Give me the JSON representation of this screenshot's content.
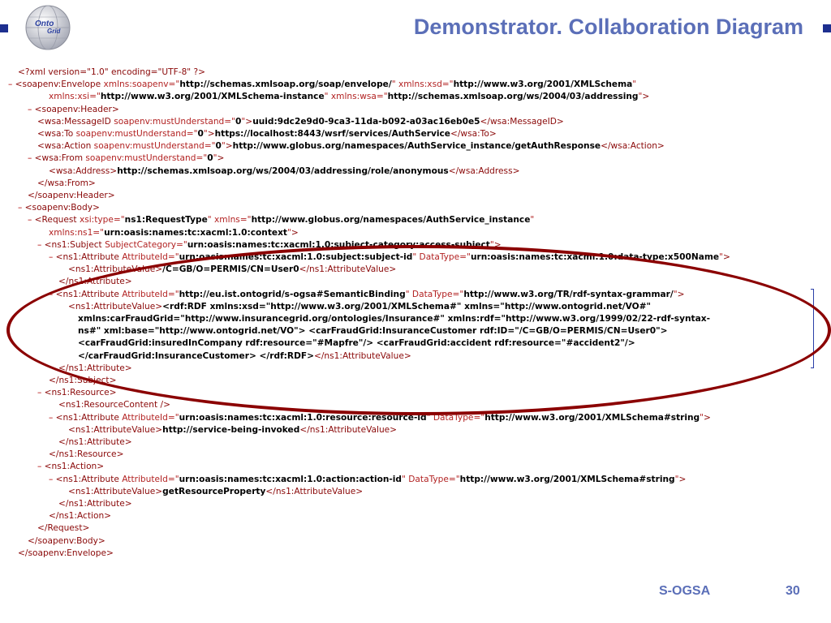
{
  "slide": {
    "title": "Demonstrator. Collaboration Diagram",
    "footer_left": "S-OGSA",
    "footer_page": "30",
    "logo_line1": "Onto",
    "logo_line2": "Grid"
  },
  "xml_lines": [
    [
      {
        "c": "tg",
        "t": "<?xml version=\"1.0\" encoding=\"UTF-8\" ?>"
      }
    ],
    [
      {
        "c": "mk",
        "t": "– "
      },
      {
        "c": "tg",
        "t": "<soapenv:Envelope "
      },
      {
        "c": "an",
        "t": "xmlns:soapenv=\""
      },
      {
        "c": "av",
        "t": "http://schemas.xmlsoap.org/soap/envelope/"
      },
      {
        "c": "an",
        "t": "\" xmlns:xsd=\""
      },
      {
        "c": "av",
        "t": "http://www.w3.org/2001/XMLSchema"
      },
      {
        "c": "an",
        "t": "\""
      }
    ],
    [
      {
        "c": "an",
        "t": "xmlns:xsi=\""
      },
      {
        "c": "av",
        "t": "http://www.w3.org/2001/XMLSchema-instance"
      },
      {
        "c": "an",
        "t": "\" xmlns:wsa=\""
      },
      {
        "c": "av",
        "t": "http://schemas.xmlsoap.org/ws/2004/03/addressing"
      },
      {
        "c": "an",
        "t": "\""
      },
      {
        "c": "tg",
        "t": ">"
      }
    ],
    [
      {
        "c": "mk",
        "t": "– "
      },
      {
        "c": "tg",
        "t": "<soapenv:Header>"
      }
    ],
    [
      {
        "c": "tg",
        "t": "<wsa:MessageID "
      },
      {
        "c": "an",
        "t": "soapenv:mustUnderstand=\""
      },
      {
        "c": "av",
        "t": "0"
      },
      {
        "c": "an",
        "t": "\""
      },
      {
        "c": "tg",
        "t": ">"
      },
      {
        "c": "tx",
        "t": "uuid:9dc2e9d0-9ca3-11da-b092-a03ac16eb0e5"
      },
      {
        "c": "tg",
        "t": "</wsa:MessageID>"
      }
    ],
    [
      {
        "c": "tg",
        "t": "<wsa:To "
      },
      {
        "c": "an",
        "t": "soapenv:mustUnderstand=\""
      },
      {
        "c": "av",
        "t": "0"
      },
      {
        "c": "an",
        "t": "\""
      },
      {
        "c": "tg",
        "t": ">"
      },
      {
        "c": "tx",
        "t": "https://localhost:8443/wsrf/services/AuthService"
      },
      {
        "c": "tg",
        "t": "</wsa:To>"
      }
    ],
    [
      {
        "c": "tg",
        "t": "<wsa:Action "
      },
      {
        "c": "an",
        "t": "soapenv:mustUnderstand=\""
      },
      {
        "c": "av",
        "t": "0"
      },
      {
        "c": "an",
        "t": "\""
      },
      {
        "c": "tg",
        "t": ">"
      },
      {
        "c": "tx",
        "t": "http://www.globus.org/namespaces/AuthService_instance/getAuthResponse"
      },
      {
        "c": "tg",
        "t": "</wsa:Action>"
      }
    ],
    [
      {
        "c": "mk",
        "t": "– "
      },
      {
        "c": "tg",
        "t": "<wsa:From "
      },
      {
        "c": "an",
        "t": "soapenv:mustUnderstand=\""
      },
      {
        "c": "av",
        "t": "0"
      },
      {
        "c": "an",
        "t": "\""
      },
      {
        "c": "tg",
        "t": ">"
      }
    ],
    [
      {
        "c": "tg",
        "t": "<wsa:Address>"
      },
      {
        "c": "tx",
        "t": "http://schemas.xmlsoap.org/ws/2004/03/addressing/role/anonymous"
      },
      {
        "c": "tg",
        "t": "</wsa:Address>"
      }
    ],
    [
      {
        "c": "tg",
        "t": "</wsa:From>"
      }
    ],
    [
      {
        "c": "tg",
        "t": "</soapenv:Header>"
      }
    ],
    [
      {
        "c": "mk",
        "t": "– "
      },
      {
        "c": "tg",
        "t": "<soapenv:Body>"
      }
    ],
    [
      {
        "c": "mk",
        "t": "– "
      },
      {
        "c": "tg",
        "t": "<Request "
      },
      {
        "c": "an",
        "t": "xsi:type=\""
      },
      {
        "c": "av",
        "t": "ns1:RequestType"
      },
      {
        "c": "an",
        "t": "\" xmlns=\""
      },
      {
        "c": "av",
        "t": "http://www.globus.org/namespaces/AuthService_instance"
      },
      {
        "c": "an",
        "t": "\""
      }
    ],
    [
      {
        "c": "an",
        "t": "xmlns:ns1=\""
      },
      {
        "c": "av",
        "t": "urn:oasis:names:tc:xacml:1.0:context"
      },
      {
        "c": "an",
        "t": "\""
      },
      {
        "c": "tg",
        "t": ">"
      }
    ],
    [
      {
        "c": "mk",
        "t": "– "
      },
      {
        "c": "tg",
        "t": "<ns1:Subject "
      },
      {
        "c": "an",
        "t": "SubjectCategory=\""
      },
      {
        "c": "av",
        "t": "urn:oasis:names:tc:xacml:1.0:subject-category:access-subject"
      },
      {
        "c": "an",
        "t": "\""
      },
      {
        "c": "tg",
        "t": ">"
      }
    ],
    [
      {
        "c": "mk",
        "t": "– "
      },
      {
        "c": "tg",
        "t": "<ns1:Attribute "
      },
      {
        "c": "an",
        "t": "AttributeId=\""
      },
      {
        "c": "av",
        "t": "urn:oasis:names:tc:xacml:1.0:subject:subject-id"
      },
      {
        "c": "an",
        "t": "\" DataType=\""
      },
      {
        "c": "av",
        "t": "urn:oasis:names:tc:xacml:1.0:data-type:x500Name"
      },
      {
        "c": "an",
        "t": "\""
      },
      {
        "c": "tg",
        "t": ">"
      }
    ],
    [
      {
        "c": "tg",
        "t": "<ns1:AttributeValue>"
      },
      {
        "c": "tx",
        "t": "/C=GB/O=PERMIS/CN=User0"
      },
      {
        "c": "tg",
        "t": "</ns1:AttributeValue>"
      }
    ],
    [
      {
        "c": "tg",
        "t": "</ns1:Attribute>"
      }
    ],
    [
      {
        "c": "mk",
        "t": "– "
      },
      {
        "c": "tg",
        "t": "<ns1:Attribute "
      },
      {
        "c": "an",
        "t": "AttributeId=\""
      },
      {
        "c": "av",
        "t": "http://eu.ist.ontogrid/s-ogsa#SemanticBinding"
      },
      {
        "c": "an",
        "t": "\" DataType=\""
      },
      {
        "c": "av",
        "t": "http://www.w3.org/TR/rdf-syntax-grammar/"
      },
      {
        "c": "an",
        "t": "\""
      },
      {
        "c": "tg",
        "t": ">"
      }
    ],
    [
      {
        "c": "tg",
        "t": "<ns1:AttributeValue>"
      },
      {
        "c": "tx",
        "t": "<rdf:RDF xmlns:xsd=\"http://www.w3.org/2001/XMLSchema#\" xmlns=\"http://www.ontogrid.net/VO#\""
      }
    ],
    [
      {
        "c": "tx",
        "t": "xmlns:carFraudGrid=\"http://www.insurancegrid.org/ontologies/Insurance#\" xmlns:rdf=\"http://www.w3.org/1999/02/22-rdf-syntax-"
      }
    ],
    [
      {
        "c": "tx",
        "t": "ns#\" xml:base=\"http://www.ontogrid.net/VO\"> <carFraudGrid:InsuranceCustomer rdf:ID=\"/C=GB/O=PERMIS/CN=User0\">"
      }
    ],
    [
      {
        "c": "tx",
        "t": "<carFraudGrid:insuredInCompany rdf:resource=\"#Mapfre\"/> <carFraudGrid:accident rdf:resource=\"#accident2\"/>"
      }
    ],
    [
      {
        "c": "tx",
        "t": "</carFraudGrid:InsuranceCustomer> </rdf:RDF>"
      },
      {
        "c": "tg",
        "t": "</ns1:AttributeValue>"
      }
    ],
    [
      {
        "c": "tg",
        "t": "</ns1:Attribute>"
      }
    ],
    [
      {
        "c": "tg",
        "t": "</ns1:Subject>"
      }
    ],
    [
      {
        "c": "mk",
        "t": "– "
      },
      {
        "c": "tg",
        "t": "<ns1:Resource>"
      }
    ],
    [
      {
        "c": "tg",
        "t": "<ns1:ResourceContent />"
      }
    ],
    [
      {
        "c": "mk",
        "t": "– "
      },
      {
        "c": "tg",
        "t": "<ns1:Attribute "
      },
      {
        "c": "an",
        "t": "AttributeId=\""
      },
      {
        "c": "av",
        "t": "urn:oasis:names:tc:xacml:1.0:resource:resource-id"
      },
      {
        "c": "an",
        "t": "\" DataType=\""
      },
      {
        "c": "av",
        "t": "http://www.w3.org/2001/XMLSchema#string"
      },
      {
        "c": "an",
        "t": "\""
      },
      {
        "c": "tg",
        "t": ">"
      }
    ],
    [
      {
        "c": "tg",
        "t": "<ns1:AttributeValue>"
      },
      {
        "c": "tx",
        "t": "http://service-being-invoked"
      },
      {
        "c": "tg",
        "t": "</ns1:AttributeValue>"
      }
    ],
    [
      {
        "c": "tg",
        "t": "</ns1:Attribute>"
      }
    ],
    [
      {
        "c": "tg",
        "t": "</ns1:Resource>"
      }
    ],
    [
      {
        "c": "mk",
        "t": "– "
      },
      {
        "c": "tg",
        "t": "<ns1:Action>"
      }
    ],
    [
      {
        "c": "mk",
        "t": "– "
      },
      {
        "c": "tg",
        "t": "<ns1:Attribute "
      },
      {
        "c": "an",
        "t": "AttributeId=\""
      },
      {
        "c": "av",
        "t": "urn:oasis:names:tc:xacml:1.0:action:action-id"
      },
      {
        "c": "an",
        "t": "\" DataType=\""
      },
      {
        "c": "av",
        "t": "http://www.w3.org/2001/XMLSchema#string"
      },
      {
        "c": "an",
        "t": "\""
      },
      {
        "c": "tg",
        "t": ">"
      }
    ],
    [
      {
        "c": "tg",
        "t": "<ns1:AttributeValue>"
      },
      {
        "c": "tx",
        "t": "getResourceProperty"
      },
      {
        "c": "tg",
        "t": "</ns1:AttributeValue>"
      }
    ],
    [
      {
        "c": "tg",
        "t": "</ns1:Attribute>"
      }
    ],
    [
      {
        "c": "tg",
        "t": "</ns1:Action>"
      }
    ],
    [
      {
        "c": "tg",
        "t": "</Request>"
      }
    ],
    [
      {
        "c": "tg",
        "t": "</soapenv:Body>"
      }
    ],
    [
      {
        "c": "tg",
        "t": "</soapenv:Envelope>"
      }
    ]
  ]
}
